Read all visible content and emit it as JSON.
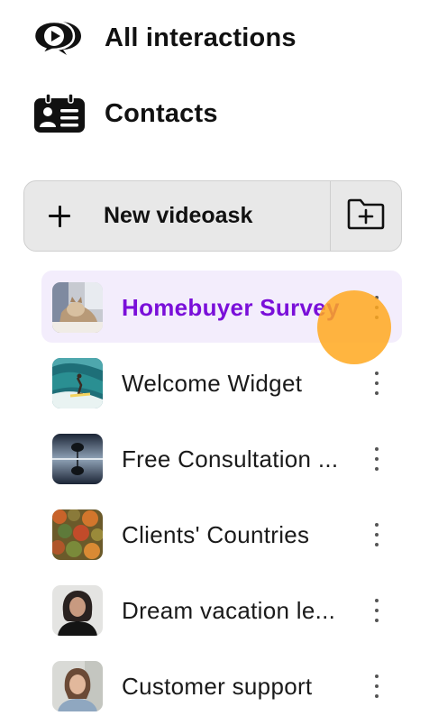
{
  "nav": {
    "all_interactions": {
      "label": "All interactions",
      "icon": "chat-play-icon"
    },
    "contacts": {
      "label": "Contacts",
      "icon": "contacts-card-icon"
    }
  },
  "new_videoask": {
    "label": "New videoask",
    "icon": "plus-icon",
    "folder_icon": "new-folder-icon"
  },
  "videoasks": [
    {
      "label": "Homebuyer Survey",
      "active": true,
      "thumb": "cat-on-bed"
    },
    {
      "label": "Welcome Widget",
      "active": false,
      "thumb": "surfer-wave"
    },
    {
      "label": "Free Consultation ...",
      "active": false,
      "thumb": "tree-reflection"
    },
    {
      "label": "Clients' Countries",
      "active": false,
      "thumb": "autumn-forest"
    },
    {
      "label": "Dream vacation le...",
      "active": false,
      "thumb": "woman-portrait"
    },
    {
      "label": "Customer support",
      "active": false,
      "thumb": "woman-smiling"
    }
  ],
  "colors": {
    "active_text": "#7a0fd9",
    "active_bg": "#f3edfc",
    "button_bg": "#e8e8e8",
    "cursor_highlight": "#ffa81e"
  }
}
